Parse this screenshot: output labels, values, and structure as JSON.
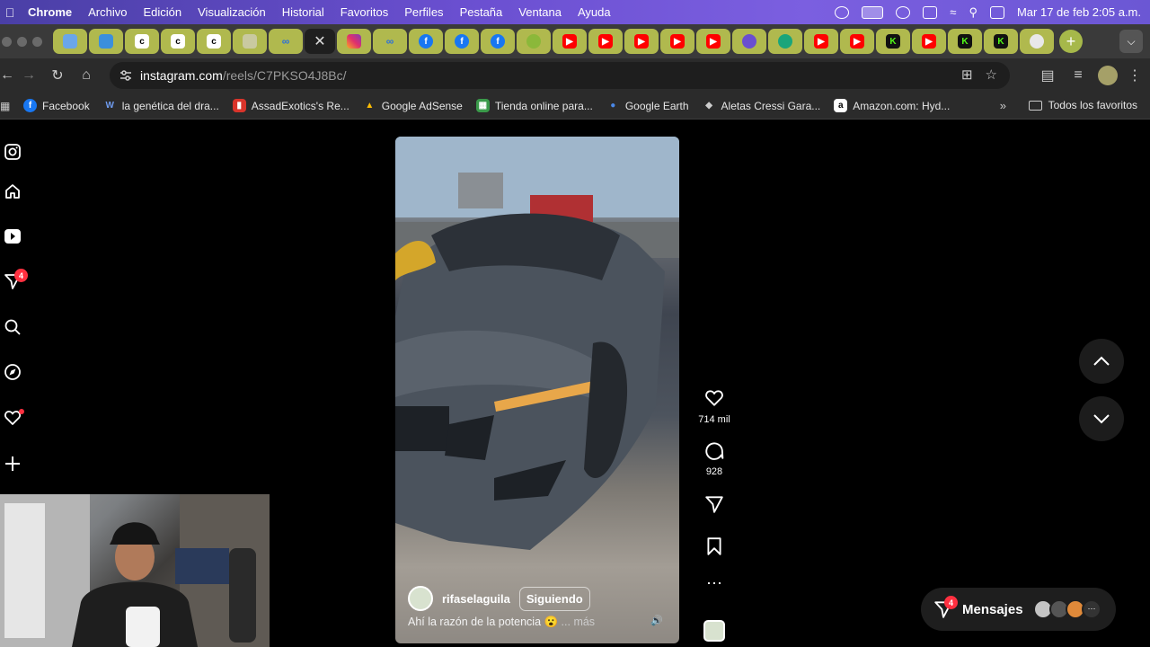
{
  "menubar": {
    "app": "Chrome",
    "items": [
      "Archivo",
      "Edición",
      "Visualización",
      "Historial",
      "Favoritos",
      "Perfiles",
      "Pestaña",
      "Ventana",
      "Ayuda"
    ],
    "clock": "Mar 17 de feb  2:05 a.m."
  },
  "browser": {
    "url_host": "instagram.com",
    "url_path": "/reels/C7PKSO4J8Bc/",
    "bookmarks": [
      {
        "label": "Facebook",
        "color": "#1877f2",
        "glyph": "f"
      },
      {
        "label": "la genética del dra...",
        "color": "#3b6fe0",
        "glyph": "W"
      },
      {
        "label": "AssadExotics's Re...",
        "color": "#d9342b",
        "glyph": "▮"
      },
      {
        "label": "Google AdSense",
        "color": "#fbbc04",
        "glyph": "▲"
      },
      {
        "label": "Tienda online para...",
        "color": "#3a9a4a",
        "glyph": "▦"
      },
      {
        "label": "Google Earth",
        "color": "#4a88e8",
        "glyph": "●"
      },
      {
        "label": "Aletas Cressi Gara...",
        "color": "#bbbbbb",
        "glyph": "◆"
      },
      {
        "label": "Amazon.com: Hyd...",
        "color": "#ffffff",
        "glyph": "a"
      }
    ],
    "all_bookmarks": "Todos los favoritos"
  },
  "reel": {
    "username": "rifaselaguila",
    "follow_label": "Siguiendo",
    "caption": "Ahí la razón de la potencia 😮",
    "more": "... más",
    "likes": "714 mil",
    "comments": "928"
  },
  "sidebar": {
    "notifications_badge": "4"
  },
  "messages": {
    "label": "Mensajes",
    "badge": "4"
  }
}
